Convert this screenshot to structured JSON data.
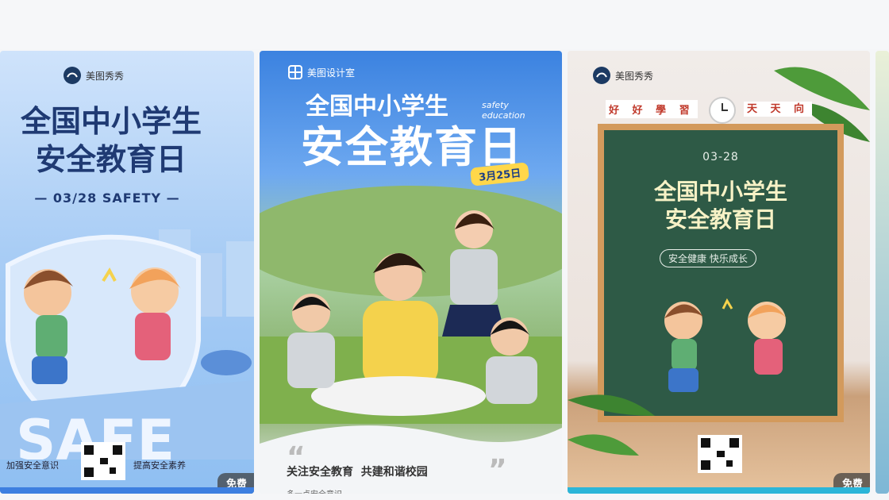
{
  "cards": [
    {
      "brand": "美图秀秀",
      "title_line1": "全国中小学生",
      "title_line2": "安全教育日",
      "date_line": "— 03/28 SAFETY —",
      "footer_left": "加强安全意识",
      "footer_right": "提高安全素养",
      "badge": "免费"
    },
    {
      "brand": "美图设计室",
      "title_line1": "全国中小学生",
      "title_line2": "安全教育日",
      "english1": "safety",
      "english2": "education",
      "date_tag": "3月25日",
      "slogan": "关注安全教育  共建和谐校园",
      "sub_slogan": "多一点安全意识"
    },
    {
      "brand": "美图秀秀",
      "banner_left": "好 好 學 習",
      "banner_right": "天 天 向",
      "date": "03-28",
      "title_line1": "全国中小学生",
      "title_line2": "安全教育日",
      "motto": "安全健康 快乐成长",
      "badge": "免费"
    }
  ],
  "colors": {
    "card1_title": "#1f3a73",
    "card2_title": "#ffffff",
    "card3_board": "#2e5a46",
    "badge_bg": "#4a4a4a"
  }
}
